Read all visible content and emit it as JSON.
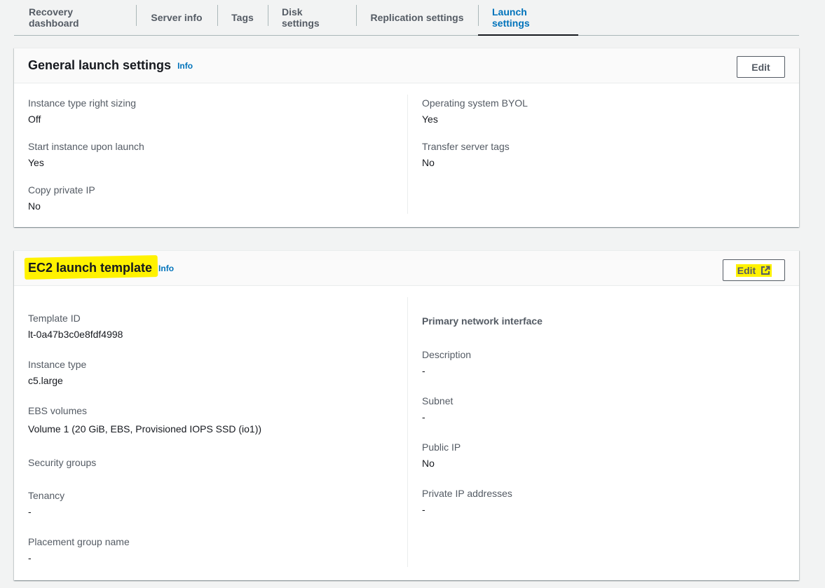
{
  "tabs": [
    {
      "label": "Recovery dashboard",
      "active": false
    },
    {
      "label": "Server info",
      "active": false
    },
    {
      "label": "Tags",
      "active": false
    },
    {
      "label": "Disk settings",
      "active": false
    },
    {
      "label": "Replication settings",
      "active": false
    },
    {
      "label": "Launch settings",
      "active": true
    }
  ],
  "general": {
    "title": "General launch settings",
    "info": "Info",
    "edit_label": "Edit",
    "left": [
      {
        "label": "Instance type right sizing",
        "value": "Off"
      },
      {
        "label": "Start instance upon launch",
        "value": "Yes"
      },
      {
        "label": "Copy private IP",
        "value": "No"
      }
    ],
    "right": [
      {
        "label": "Operating system BYOL",
        "value": "Yes"
      },
      {
        "label": "Transfer server tags",
        "value": "No"
      }
    ]
  },
  "ec2": {
    "title": "EC2 launch template",
    "info": "Info",
    "edit_label": "Edit",
    "edit_icon": "external-link-icon",
    "left": [
      {
        "label": "Template ID",
        "value": "lt-0a47b3c0e8fdf4998"
      },
      {
        "label": "Instance type",
        "value": "c5.large"
      },
      {
        "label": "EBS volumes",
        "value": "Volume 1 (20 GiB, EBS, Provisioned IOPS SSD (io1))"
      },
      {
        "label": "Security groups",
        "value": ""
      },
      {
        "label": "Tenancy",
        "value": "-"
      },
      {
        "label": "Placement group name",
        "value": "-"
      }
    ],
    "right_section_title": "Primary network interface",
    "right": [
      {
        "label": "Description",
        "value": "-"
      },
      {
        "label": "Subnet",
        "value": "-"
      },
      {
        "label": "Public IP",
        "value": "No"
      },
      {
        "label": "Private IP addresses",
        "value": "-"
      }
    ]
  },
  "colors": {
    "accent": "#0073bb",
    "highlight": "#fff200",
    "label": "#545b64",
    "text": "#16191f"
  }
}
